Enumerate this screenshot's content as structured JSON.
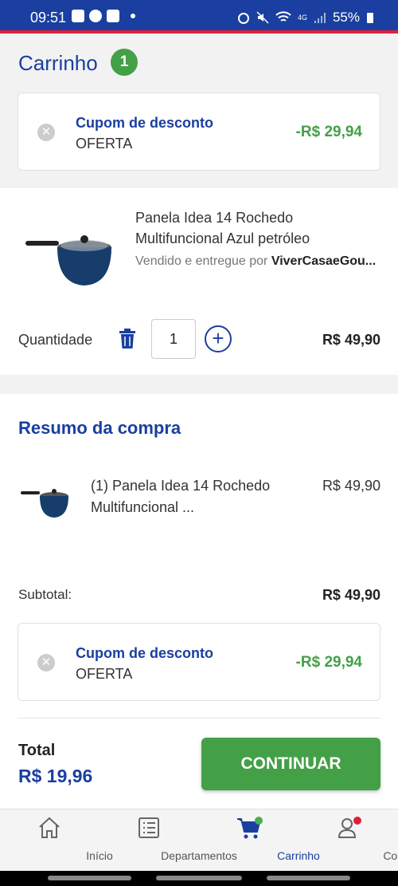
{
  "status_bar": {
    "time": "09:51",
    "battery": "55%",
    "network": "4G"
  },
  "header": {
    "title": "Carrinho",
    "count": "1"
  },
  "coupon": {
    "title": "Cupom de desconto",
    "code": "OFERTA",
    "value": "-R$ 29,94"
  },
  "product": {
    "name": "Panela Idea 14 Rochedo Multifuncional Azul petróleo",
    "seller_prefix": "Vendido e entregue por ",
    "seller": "ViverCasaeGou...",
    "quantity_label": "Quantidade",
    "quantity": "1",
    "price": "R$ 49,90"
  },
  "summary": {
    "title": "Resumo da compra",
    "item_name": "(1) Panela Idea 14 Rochedo Multifuncional ...",
    "item_price": "R$ 49,90",
    "subtotal_label": "Subtotal:",
    "subtotal_value": "R$ 49,90",
    "coupon_title": "Cupom de desconto",
    "coupon_code": "OFERTA",
    "coupon_value": "-R$ 29,94",
    "total_label": "Total",
    "total_value": "R$ 19,96",
    "continue_label": "CONTINUAR"
  },
  "nav": [
    {
      "label": "Início",
      "icon": "home-icon"
    },
    {
      "label": "Departamentos",
      "icon": "list-icon"
    },
    {
      "label": "Carrinho",
      "icon": "cart-icon",
      "active": true
    },
    {
      "label": "Conta",
      "icon": "account-icon"
    }
  ],
  "colors": {
    "primary": "#1a3fa0",
    "accent": "#43a047",
    "alert": "#e0203a"
  }
}
